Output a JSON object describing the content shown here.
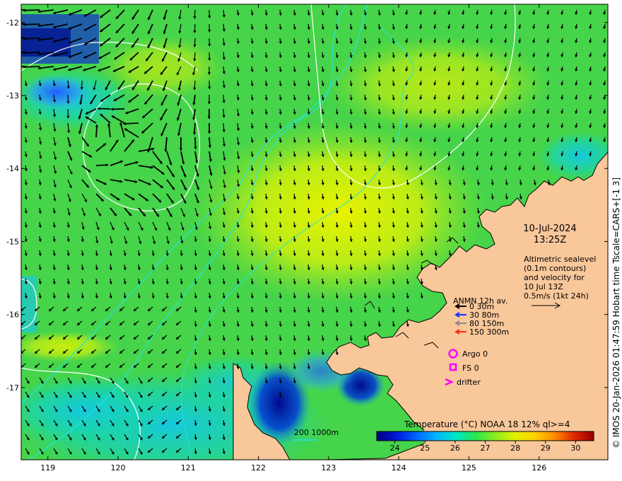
{
  "map": {
    "lon_ticks": [
      "119",
      "120",
      "121",
      "122",
      "123",
      "124",
      "125",
      "126"
    ],
    "lat_ticks": [
      "-12",
      "-13",
      "-14",
      "-15",
      "-16",
      "-17"
    ],
    "lon_range": [
      118.62,
      126.98
    ],
    "lat_range": [
      -17.99,
      -11.75
    ],
    "land_color": "#f8c79a",
    "contour_color": "#ffffff",
    "isobath_color": "#22e3e3",
    "vector_color": "#000000"
  },
  "datetime": {
    "date": "10-Jul-2024",
    "time": "13:25Z"
  },
  "description": {
    "line1": "Altimetric sealevel",
    "line2": "(0.1m contours)",
    "line3": "and velocity for",
    "line4": "10 Jul 13Z",
    "line5": "0.5m/s (1kt 24h)"
  },
  "anmn_legend": {
    "title": "ANMN 12h av.",
    "items": [
      {
        "label": "0 30m",
        "color": "#000000"
      },
      {
        "label": "30 80m",
        "color": "#1530ff"
      },
      {
        "label": "80 150m",
        "color": "#8a8a8a"
      },
      {
        "label": "150 300m",
        "color": "#ff2a1a"
      }
    ]
  },
  "markers": {
    "argo": {
      "label": "Argo 0",
      "color": "#ff00ff"
    },
    "fs": {
      "label": "FS 0",
      "color": "#ff00ff"
    },
    "drifter": {
      "label": "drifter",
      "color": "#ff00ff"
    }
  },
  "depth_legend": {
    "label": "200  1000m",
    "color": "#22e3e3"
  },
  "colorbar": {
    "title": "Temperature (°C) NOAA 18 12% ql>=4",
    "ticks": [
      "24",
      "25",
      "26",
      "27",
      "28",
      "29",
      "30"
    ],
    "range": [
      23.4,
      30.6
    ],
    "colors": [
      "#00007a",
      "#0018d8",
      "#0064ff",
      "#00b4ff",
      "#00e6c8",
      "#28e650",
      "#8ced1e",
      "#e0f000",
      "#ffd200",
      "#ff8c00",
      "#e02800",
      "#960000"
    ]
  },
  "credit": "© IMOS 20-Jan-2026 01:47:59 Hobart time Tscale=CARS+[-1 3]"
}
